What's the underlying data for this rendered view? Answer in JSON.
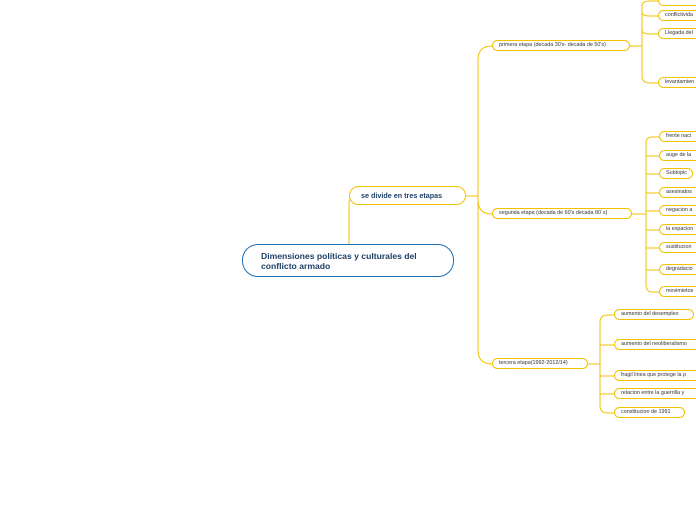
{
  "colors": {
    "root_border": "#1f6fb2",
    "branch": "#f2c200",
    "root_text": "#1e3f66"
  },
  "map": {
    "root": "Dimensiones políticas y culturales del conflicto armado",
    "level1": "se divide en tres etapas",
    "stages": [
      {
        "label": "primera etapa (decada 30's- decada de 50's)",
        "children": [
          "",
          "conflictivida",
          "Llegada del",
          "levantamien"
        ]
      },
      {
        "label": "segunda etapa (decada de 60's decada 80´s)",
        "children": [
          "frente naci",
          "auge de la",
          "Subtopic",
          "asesinatos",
          "negacion a",
          "la expacion",
          "sustitucion",
          "degradacio",
          "movimietos"
        ]
      },
      {
        "label": "tercera etapa(1992-2012/14)",
        "children": [
          "aumento del desempleo",
          "aumento del neoliberalismo",
          "fragil linea que protege la p",
          "relacion entre la guerrilla y",
          "constitucion de 1991"
        ]
      }
    ]
  }
}
